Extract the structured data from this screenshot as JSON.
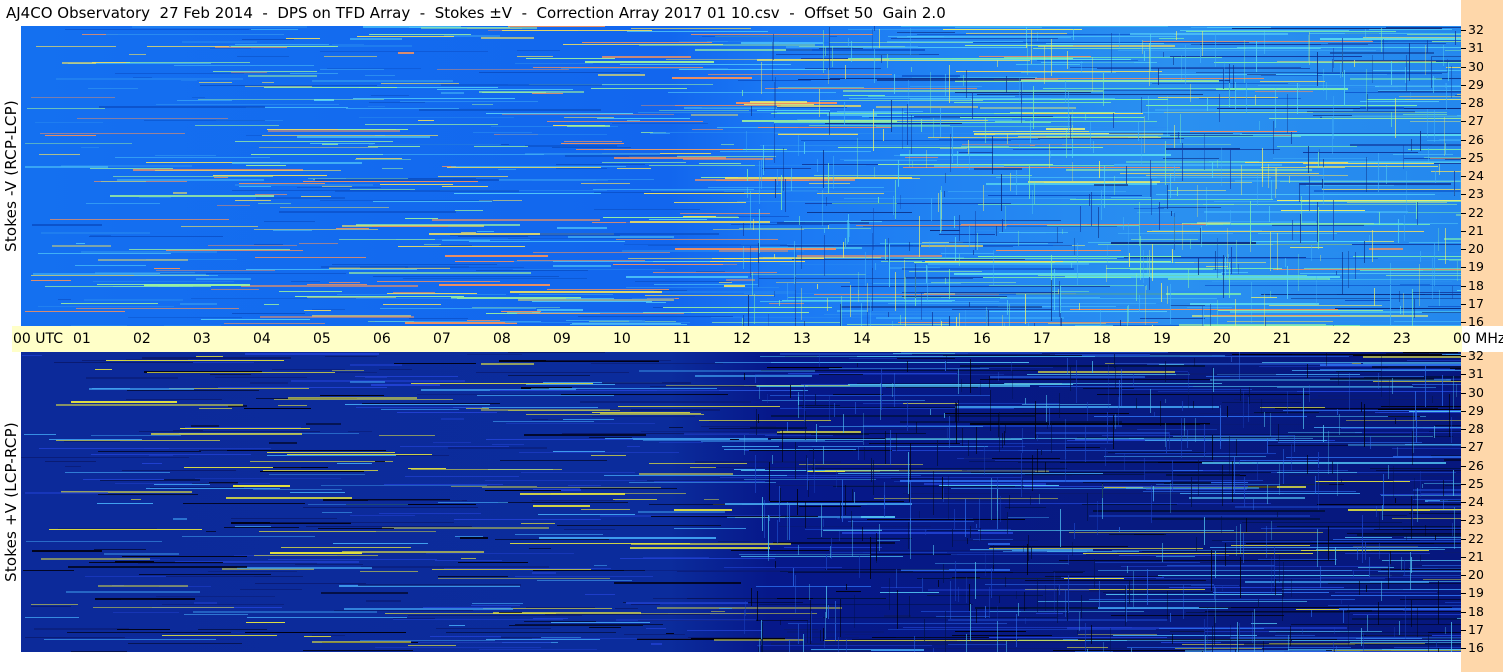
{
  "title": "AJ4CO Observatory  27 Feb 2014  -  DPS on TFD Array  -  Stokes ±V  -  Correction Array 2017 01 10.csv  -  Offset 50  Gain 2.0",
  "top_panel_label": "Stokes -V (RCP-LCP)",
  "bottom_panel_label": "Stokes +V (LCP-RCP)",
  "time_axis": {
    "labels": [
      "00 UTC",
      "01",
      "02",
      "03",
      "04",
      "05",
      "06",
      "07",
      "08",
      "09",
      "10",
      "11",
      "12",
      "13",
      "14",
      "15",
      "16",
      "17",
      "18",
      "19",
      "20",
      "21",
      "22",
      "23",
      "00 MHz"
    ]
  },
  "freq_axis": {
    "labels": [
      "32",
      "31",
      "30",
      "29",
      "28",
      "27",
      "26",
      "25",
      "24",
      "23",
      "22",
      "21",
      "20",
      "19",
      "18",
      "17",
      "16"
    ],
    "unit": "MHz"
  }
}
